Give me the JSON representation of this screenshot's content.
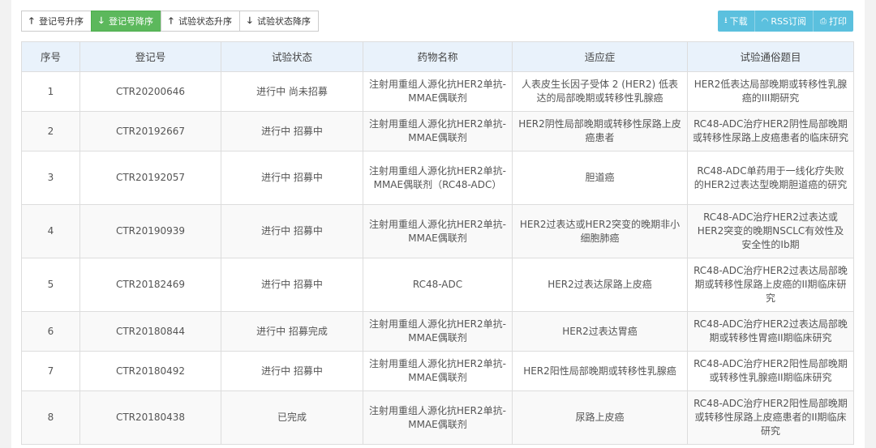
{
  "sort_buttons": [
    {
      "arrow": "🡑",
      "label": "登记号升序",
      "active": false
    },
    {
      "arrow": "🡓",
      "label": "登记号降序",
      "active": true
    },
    {
      "arrow": "🡑",
      "label": "试验状态升序",
      "active": false
    },
    {
      "arrow": "🡓",
      "label": "试验状态降序",
      "active": false
    }
  ],
  "actions": [
    {
      "icon": "⭳",
      "label": "下载",
      "icon_name": "download-icon"
    },
    {
      "icon": "◠",
      "label": "RSS订阅",
      "icon_name": "rss-icon"
    },
    {
      "icon": "⎙",
      "label": "打印",
      "icon_name": "print-icon"
    }
  ],
  "colors": {
    "accent_green": "#5cb85c",
    "accent_blue": "#5bc0de",
    "header_bg": "#e9f2fb"
  },
  "table": {
    "headers": [
      "序号",
      "登记号",
      "试验状态",
      "药物名称",
      "适应症",
      "试验通俗题目"
    ],
    "rows": [
      [
        "1",
        "CTR20200646",
        "进行中 尚未招募",
        "注射用重组人源化抗HER2单抗-MMAE偶联剂",
        "人表皮生长因子受体 2 (HER2) 低表达的局部晚期或转移性乳腺癌",
        "HER2低表达局部晚期或转移性乳腺癌的III期研究"
      ],
      [
        "2",
        "CTR20192667",
        "进行中 招募中",
        "注射用重组人源化抗HER2单抗-MMAE偶联剂",
        "HER2阴性局部晚期或转移性尿路上皮癌患者",
        "RC48-ADC治疗HER2阴性局部晚期或转移性尿路上皮癌患者的临床研究"
      ],
      [
        "3",
        "CTR20192057",
        "进行中 招募中",
        "注射用重组人源化抗HER2单抗-MMAE偶联剂（RC48-ADC）",
        "胆道癌",
        "RC48-ADC单药用于一线化疗失败的HER2过表达型晚期胆道癌的研究"
      ],
      [
        "4",
        "CTR20190939",
        "进行中 招募中",
        "注射用重组人源化抗HER2单抗-MMAE偶联剂",
        "HER2过表达或HER2突变的晚期非小细胞肺癌",
        "RC48-ADC治疗HER2过表达或HER2突变的晚期NSCLC有效性及安全性的Ib期"
      ],
      [
        "5",
        "CTR20182469",
        "进行中 招募中",
        "RC48-ADC",
        "HER2过表达尿路上皮癌",
        "RC48-ADC治疗HER2过表达局部晚期或转移性尿路上皮癌的II期临床研究"
      ],
      [
        "6",
        "CTR20180844",
        "进行中 招募完成",
        "注射用重组人源化抗HER2单抗-MMAE偶联剂",
        "HER2过表达胃癌",
        "RC48-ADC治疗HER2过表达局部晚期或转移性胃癌II期临床研究"
      ],
      [
        "7",
        "CTR20180492",
        "进行中 招募中",
        "注射用重组人源化抗HER2单抗-MMAE偶联剂",
        "HER2阳性局部晚期或转移性乳腺癌",
        "RC48-ADC治疗HER2阳性局部晚期或转移性乳腺癌II期临床研究"
      ],
      [
        "8",
        "CTR20180438",
        "已完成",
        "注射用重组人源化抗HER2单抗-MMAE偶联剂",
        "尿路上皮癌",
        "RC48-ADC治疗HER2阳性局部晚期或转移性尿路上皮癌患者的II期临床研究"
      ]
    ]
  }
}
